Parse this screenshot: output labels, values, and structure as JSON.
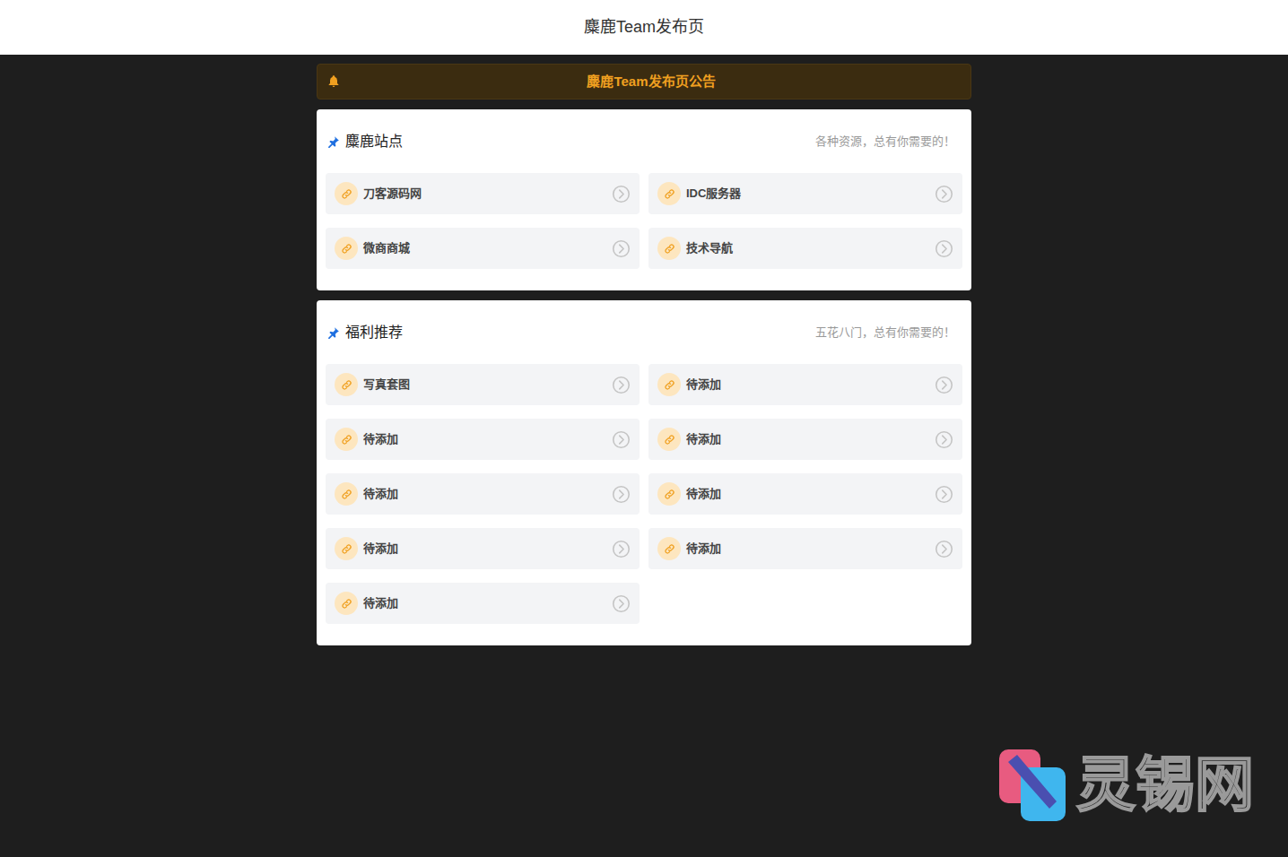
{
  "header": {
    "title": "麋鹿Team发布页"
  },
  "notice": {
    "text": "麋鹿Team发布页公告"
  },
  "sections": [
    {
      "title": "麋鹿站点",
      "subtitle": "各种资源，总有你需要的！",
      "links": [
        {
          "label": "刀客源码网"
        },
        {
          "label": "IDC服务器"
        },
        {
          "label": "微商商城"
        },
        {
          "label": "技术导航"
        }
      ]
    },
    {
      "title": "福利推荐",
      "subtitle": "五花八门，总有你需要的！",
      "links": [
        {
          "label": "写真套图"
        },
        {
          "label": "待添加"
        },
        {
          "label": "待添加"
        },
        {
          "label": "待添加"
        },
        {
          "label": "待添加"
        },
        {
          "label": "待添加"
        },
        {
          "label": "待添加"
        },
        {
          "label": "待添加"
        },
        {
          "label": "待添加"
        }
      ]
    }
  ],
  "watermark": {
    "text": "灵锡网"
  }
}
